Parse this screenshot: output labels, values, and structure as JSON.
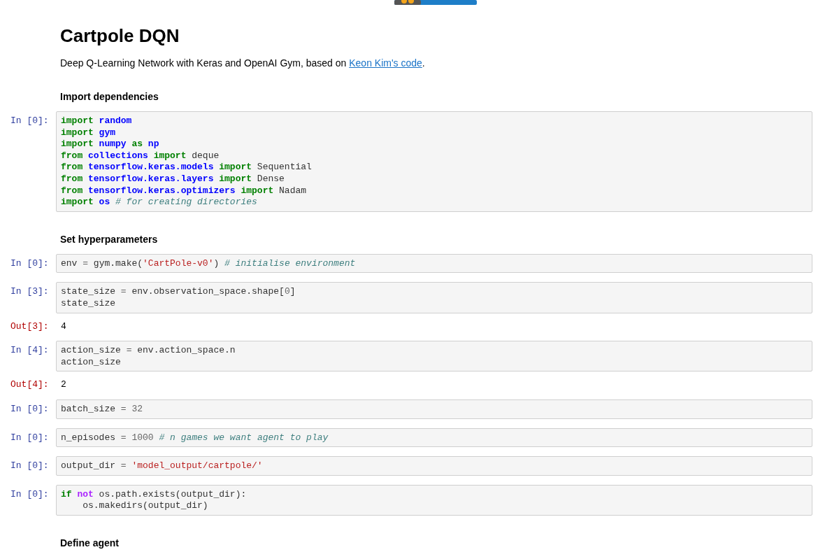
{
  "title": "Cartpole DQN",
  "intro": {
    "text": "Deep Q-Learning Network with Keras and OpenAI Gym, based on ",
    "link": "Keon Kim's code",
    "end": "."
  },
  "cells": [
    {
      "kind": "heading",
      "text": "Import dependencies"
    },
    {
      "kind": "code",
      "prompt": "In [0]:",
      "lines": [
        [
          {
            "kind": "keyword",
            "text": "import "
          },
          {
            "kind": "module",
            "text": "random"
          }
        ],
        [
          {
            "kind": "keyword",
            "text": "import "
          },
          {
            "kind": "module",
            "text": "gym"
          }
        ],
        [
          {
            "kind": "keyword",
            "text": "import "
          },
          {
            "kind": "module",
            "text": "numpy "
          },
          {
            "kind": "keyword",
            "text": "as "
          },
          {
            "kind": "module",
            "text": "np"
          }
        ],
        [
          {
            "kind": "keyword",
            "text": "from "
          },
          {
            "kind": "module",
            "text": "collections "
          },
          {
            "kind": "keyword",
            "text": "import"
          },
          {
            "kind": "name",
            "text": " deque"
          }
        ],
        [
          {
            "kind": "keyword",
            "text": "from "
          },
          {
            "kind": "module",
            "text": "tensorflow.keras.models "
          },
          {
            "kind": "keyword",
            "text": "import"
          },
          {
            "kind": "name",
            "text": " Sequential"
          }
        ],
        [
          {
            "kind": "keyword",
            "text": "from "
          },
          {
            "kind": "module",
            "text": "tensorflow.keras.layers "
          },
          {
            "kind": "keyword",
            "text": "import"
          },
          {
            "kind": "name",
            "text": " Dense"
          }
        ],
        [
          {
            "kind": "keyword",
            "text": "from "
          },
          {
            "kind": "module",
            "text": "tensorflow.keras.optimizers "
          },
          {
            "kind": "keyword",
            "text": "import"
          },
          {
            "kind": "name",
            "text": " Nadam"
          }
        ],
        [
          {
            "kind": "keyword",
            "text": "import "
          },
          {
            "kind": "module",
            "text": "os "
          },
          {
            "kind": "comment",
            "text": "# for creating directories"
          }
        ]
      ]
    },
    {
      "kind": "heading",
      "text": "Set hyperparameters"
    },
    {
      "kind": "code",
      "prompt": "In [0]:",
      "lines": [
        [
          {
            "kind": "name",
            "text": "env "
          },
          {
            "kind": "operator",
            "text": "="
          },
          {
            "kind": "name",
            "text": " gym.make("
          },
          {
            "kind": "string",
            "text": "'CartPole-v0'"
          },
          {
            "kind": "name",
            "text": ") "
          },
          {
            "kind": "comment",
            "text": "# initialise environment"
          }
        ]
      ]
    },
    {
      "kind": "code",
      "prompt": "In [3]:",
      "lines": [
        [
          {
            "kind": "name",
            "text": "state_size "
          },
          {
            "kind": "operator",
            "text": "="
          },
          {
            "kind": "name",
            "text": " env.observation_space.shape["
          },
          {
            "kind": "number",
            "text": "0"
          },
          {
            "kind": "name",
            "text": "]"
          }
        ],
        [
          {
            "kind": "name",
            "text": "state_size"
          }
        ]
      ]
    },
    {
      "kind": "output",
      "prompt": "Out[3]:",
      "text": "4"
    },
    {
      "kind": "code",
      "prompt": "In [4]:",
      "lines": [
        [
          {
            "kind": "name",
            "text": "action_size "
          },
          {
            "kind": "operator",
            "text": "="
          },
          {
            "kind": "name",
            "text": " env.action_space.n"
          }
        ],
        [
          {
            "kind": "name",
            "text": "action_size"
          }
        ]
      ]
    },
    {
      "kind": "output",
      "prompt": "Out[4]:",
      "text": "2"
    },
    {
      "kind": "code",
      "prompt": "In [0]:",
      "lines": [
        [
          {
            "kind": "name",
            "text": "batch_size "
          },
          {
            "kind": "operator",
            "text": "="
          },
          {
            "kind": "number",
            "text": " 32"
          }
        ]
      ]
    },
    {
      "kind": "code",
      "prompt": "In [0]:",
      "lines": [
        [
          {
            "kind": "name",
            "text": "n_episodes "
          },
          {
            "kind": "operator",
            "text": "="
          },
          {
            "kind": "number",
            "text": " 1000 "
          },
          {
            "kind": "comment",
            "text": "# n games we want agent to play"
          }
        ]
      ]
    },
    {
      "kind": "code",
      "prompt": "In [0]:",
      "lines": [
        [
          {
            "kind": "name",
            "text": "output_dir "
          },
          {
            "kind": "operator",
            "text": "="
          },
          {
            "kind": "string",
            "text": " 'model_output/cartpole/'"
          }
        ]
      ]
    },
    {
      "kind": "code",
      "prompt": "In [0]:",
      "lines": [
        [
          {
            "kind": "keyword",
            "text": "if "
          },
          {
            "kind": "operator-word",
            "text": "not"
          },
          {
            "kind": "name",
            "text": " os.path.exists(output_dir):"
          }
        ],
        [
          {
            "kind": "name",
            "text": "    os.makedirs(output_dir)"
          }
        ]
      ]
    },
    {
      "kind": "heading",
      "text": "Define agent"
    }
  ]
}
